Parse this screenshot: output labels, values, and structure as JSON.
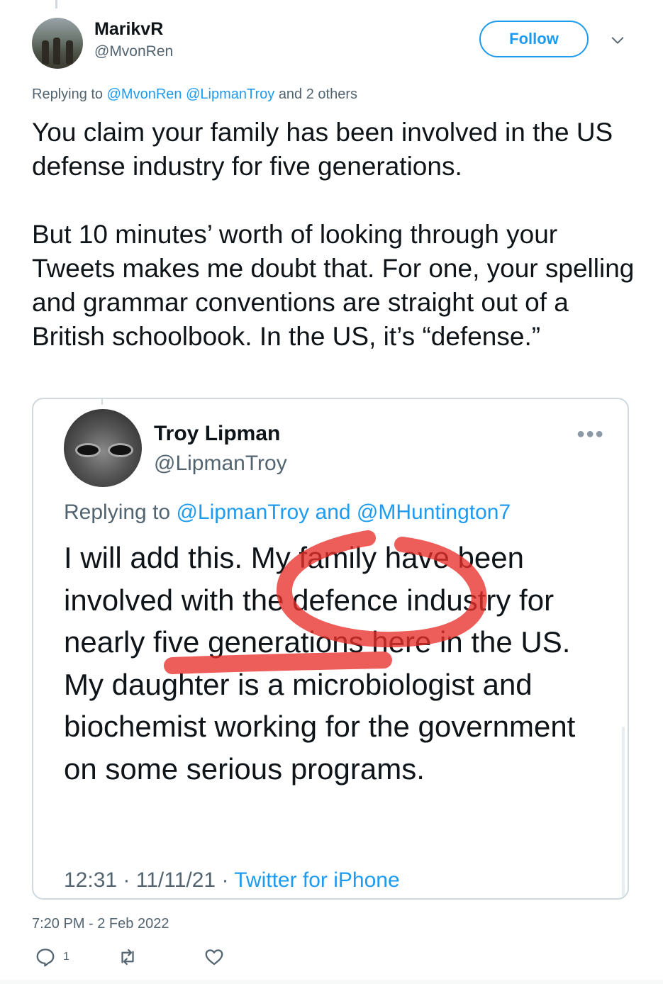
{
  "author": {
    "display_name": "MarikvR",
    "handle": "@MvonRen"
  },
  "follow_button": "Follow",
  "replying": {
    "prefix": "Replying to",
    "mention_1": "@MvonRen",
    "mention_2": "@LipmanTroy",
    "suffix": "and 2 others"
  },
  "tweet": {
    "paragraph_1": "You claim your family has been involved in the US defense industry for five generations.",
    "paragraph_2": "But 10 minutes’ worth of looking through your Tweets makes me doubt that. For one, your spelling and grammar conventions are straight out of a British schoolbook. In the US, it’s “defense.”"
  },
  "quoted": {
    "display_name": "Troy Lipman",
    "handle": "@LipmanTroy",
    "replying_prefix": "Replying to",
    "mention_1": "@LipmanTroy",
    "joiner": "and",
    "mention_2": "@MHuntington7",
    "text": "I will add this. My family have been involved with the defence industry for nearly five generations here in the US. My daughter is a microbiologist and biochemist working for the government on some serious programs.",
    "time": "12:31",
    "date": "11/11/21",
    "source": "Twitter for iPhone",
    "separator": "·",
    "markup_color": "#e8302a"
  },
  "timestamp": "7:20 PM - 2 Feb 2022",
  "actions": {
    "reply_count": "1",
    "retweet_count": "",
    "like_count": ""
  },
  "colors": {
    "link": "#1d9bf0",
    "secondary_text": "#536471",
    "border": "#cfd9de"
  }
}
